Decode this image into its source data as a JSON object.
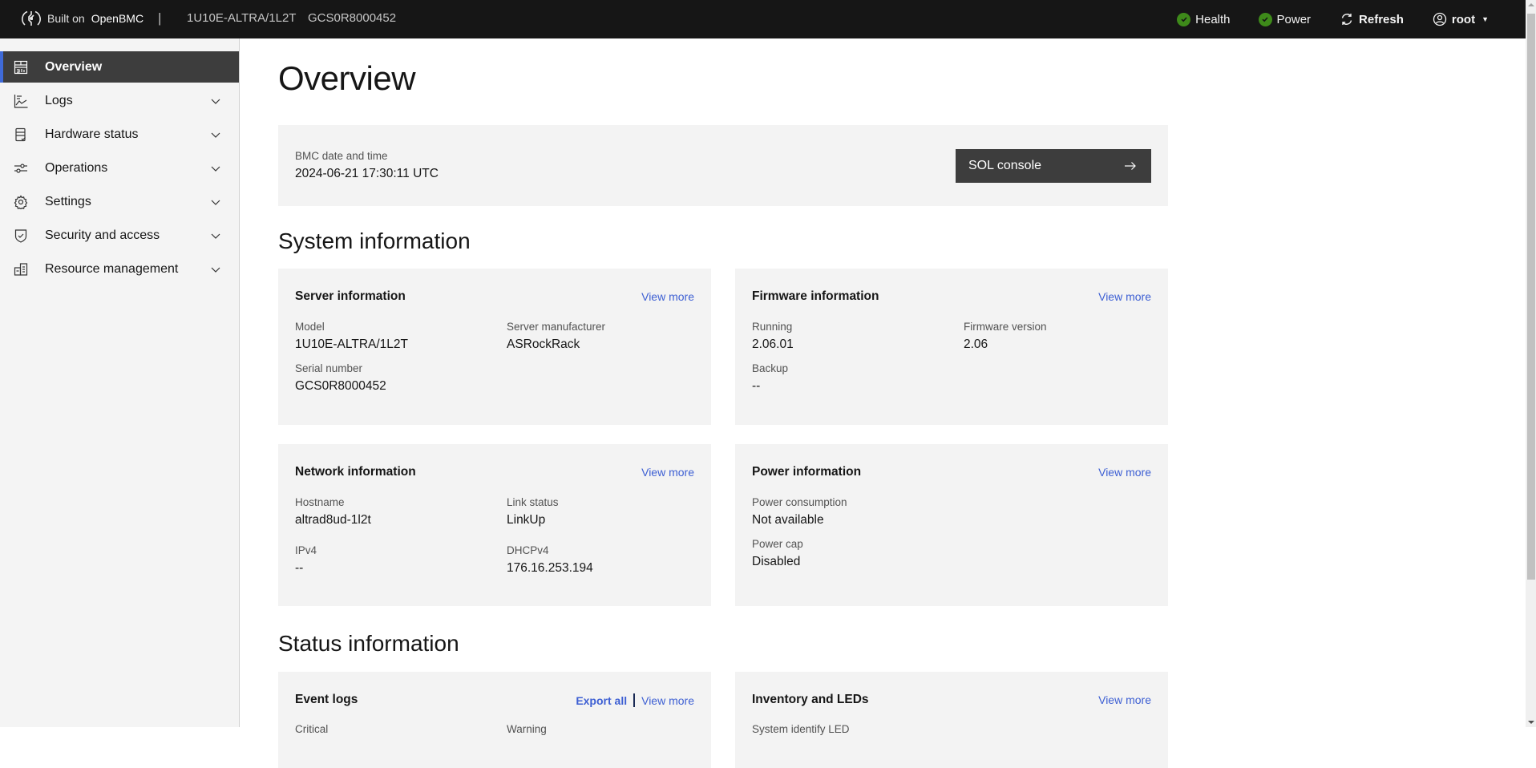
{
  "header": {
    "brand_prefix": "Built on",
    "brand_name": "OpenBMC",
    "separator": "|",
    "model": "1U10E-ALTRA/1L2T",
    "serial": "GCS0R8000452",
    "health_label": "Health",
    "power_label": "Power",
    "refresh_label": "Refresh",
    "user_label": "root",
    "status_color": "#3e8a1a"
  },
  "sidebar": {
    "items": [
      {
        "label": "Overview",
        "icon": "overview-icon",
        "active": true
      },
      {
        "label": "Logs",
        "icon": "logs-chart-icon"
      },
      {
        "label": "Hardware status",
        "icon": "hardware-checklist-icon"
      },
      {
        "label": "Operations",
        "icon": "sliders-icon"
      },
      {
        "label": "Settings",
        "icon": "gear-icon"
      },
      {
        "label": "Security and access",
        "icon": "shield-check-icon"
      },
      {
        "label": "Resource management",
        "icon": "resource-building-icon"
      }
    ]
  },
  "main": {
    "title": "Overview",
    "bmc_time": {
      "label": "BMC date and time",
      "value": "2024-06-21 17:30:11 UTC",
      "sol_button": "SOL console"
    },
    "system_section_title": "System information",
    "server": {
      "title": "Server information",
      "link": "View more",
      "fields": [
        {
          "label": "Model",
          "value": "1U10E-ALTRA/1L2T"
        },
        {
          "label": "Server manufacturer",
          "value": "ASRockRack"
        },
        {
          "label": "Serial number",
          "value": "GCS0R8000452"
        }
      ]
    },
    "firmware": {
      "title": "Firmware information",
      "link": "View more",
      "fields": [
        {
          "label": "Running",
          "value": "2.06.01"
        },
        {
          "label": "Firmware version",
          "value": "2.06"
        },
        {
          "label": "Backup",
          "value": "--"
        }
      ]
    },
    "network": {
      "title": "Network information",
      "link": "View more",
      "fields": [
        {
          "label": "Hostname",
          "value": "altrad8ud-1l2t"
        },
        {
          "label": "Link status",
          "value": "LinkUp"
        },
        {
          "label": "IPv4",
          "value": "--"
        },
        {
          "label": "DHCPv4",
          "value": "176.16.253.194"
        }
      ]
    },
    "power": {
      "title": "Power information",
      "link": "View more",
      "fields": [
        {
          "label": "Power consumption",
          "value": "Not available"
        },
        {
          "label": "Power cap",
          "value": "Disabled"
        }
      ]
    },
    "status_section_title": "Status information",
    "event_logs": {
      "title": "Event logs",
      "export_link": "Export all",
      "link": "View more",
      "partial_labels": [
        "Critical",
        "Warning"
      ]
    },
    "inventory": {
      "title": "Inventory and LEDs",
      "link": "View more",
      "partial_labels": [
        "System identify LED"
      ]
    }
  }
}
